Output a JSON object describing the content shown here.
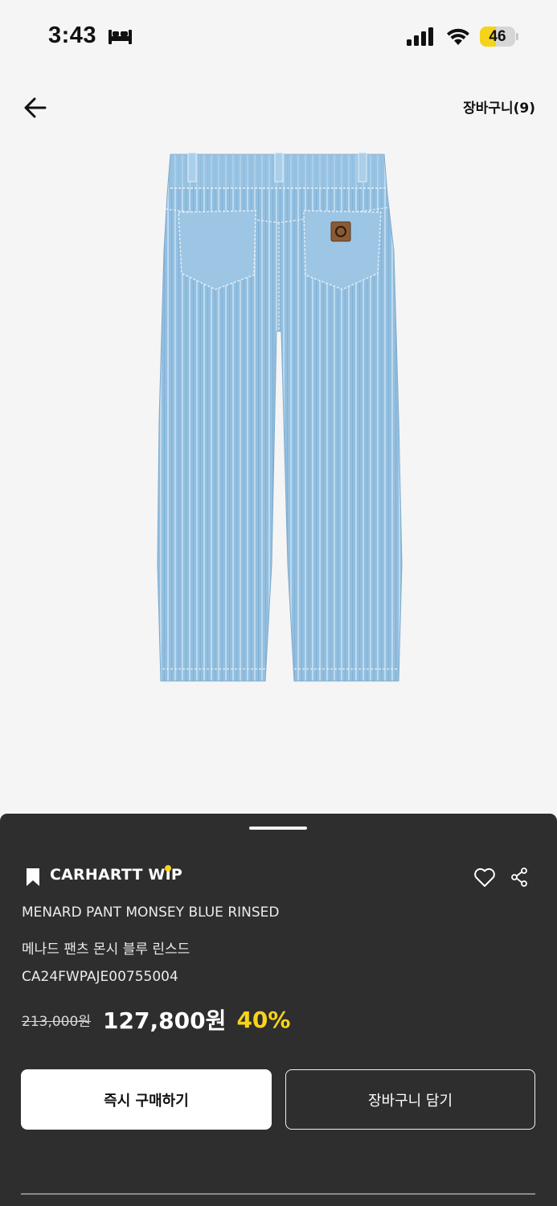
{
  "status_bar": {
    "time": "3:43",
    "battery_level": "46",
    "battery_fraction": 0.46,
    "icons": [
      "bed-icon",
      "signal-icon",
      "wifi-icon",
      "battery-icon"
    ]
  },
  "nav": {
    "back_icon": "arrow-left-icon",
    "cart_label": "장바구니(9)"
  },
  "product": {
    "image": "light blue striped denim pants (back view)",
    "brand": "CARHARTT WIP",
    "name_en": "MENARD PANT MONSEY BLUE RINSED",
    "name_ko": "메나드 팬츠 몬시 블루 린스드",
    "sku": "CA24FWPAJE00755004",
    "original_price": "213,000원",
    "sale_price": "127,800원",
    "discount": "40%"
  },
  "actions": {
    "buy_now": "즉시 구매하기",
    "add_to_cart": "장바구니 담기"
  },
  "colors": {
    "accent": "#f8d31b",
    "sheet_bg": "#2e2e2e",
    "page_bg": "#f5f5f5"
  }
}
